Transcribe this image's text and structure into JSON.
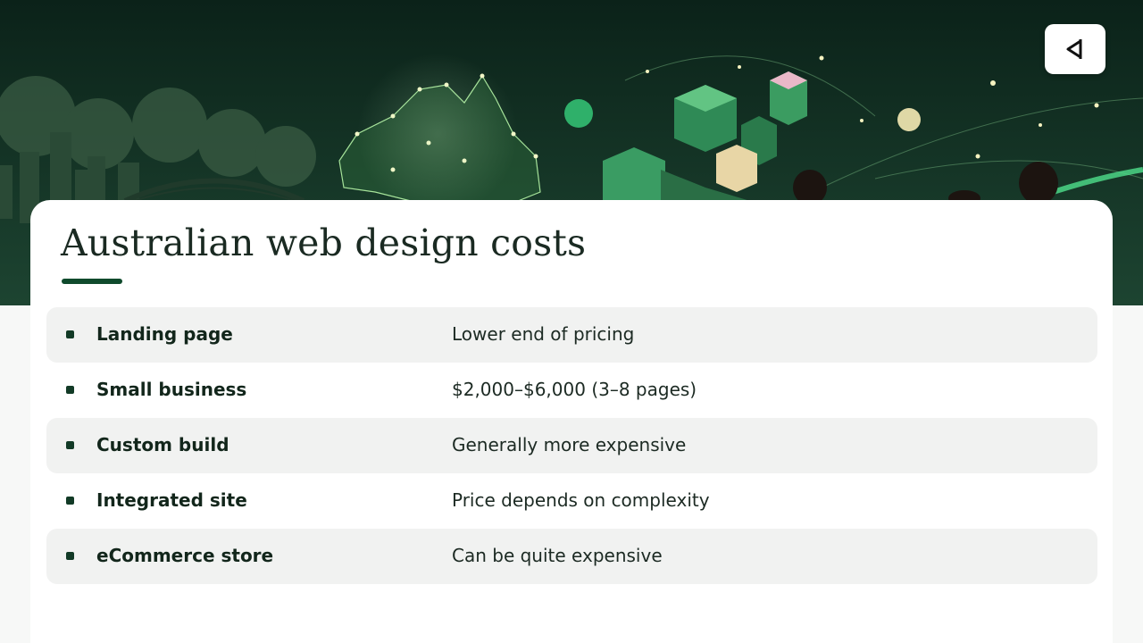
{
  "slide": {
    "title": "Australian web design costs",
    "rows": [
      {
        "label": "Landing page",
        "value": "Lower end of pricing"
      },
      {
        "label": "Small business",
        "value": "$2,000–$6,000 (3–8 pages)"
      },
      {
        "label": "Custom build",
        "value": "Generally more expensive"
      },
      {
        "label": "Integrated site",
        "value": "Price depends on complexity"
      },
      {
        "label": "eCommerce store",
        "value": "Can be quite expensive"
      }
    ]
  },
  "theme": {
    "accent": "#0f4a2c",
    "hero_dark": "#0a1f17",
    "hero_green": "#3fae6e",
    "row_shade": "#f1f2f1",
    "card": "#ffffff"
  },
  "icons": {
    "logo": "back-arrow-logo-icon",
    "bullet": "square-bullet-icon"
  }
}
